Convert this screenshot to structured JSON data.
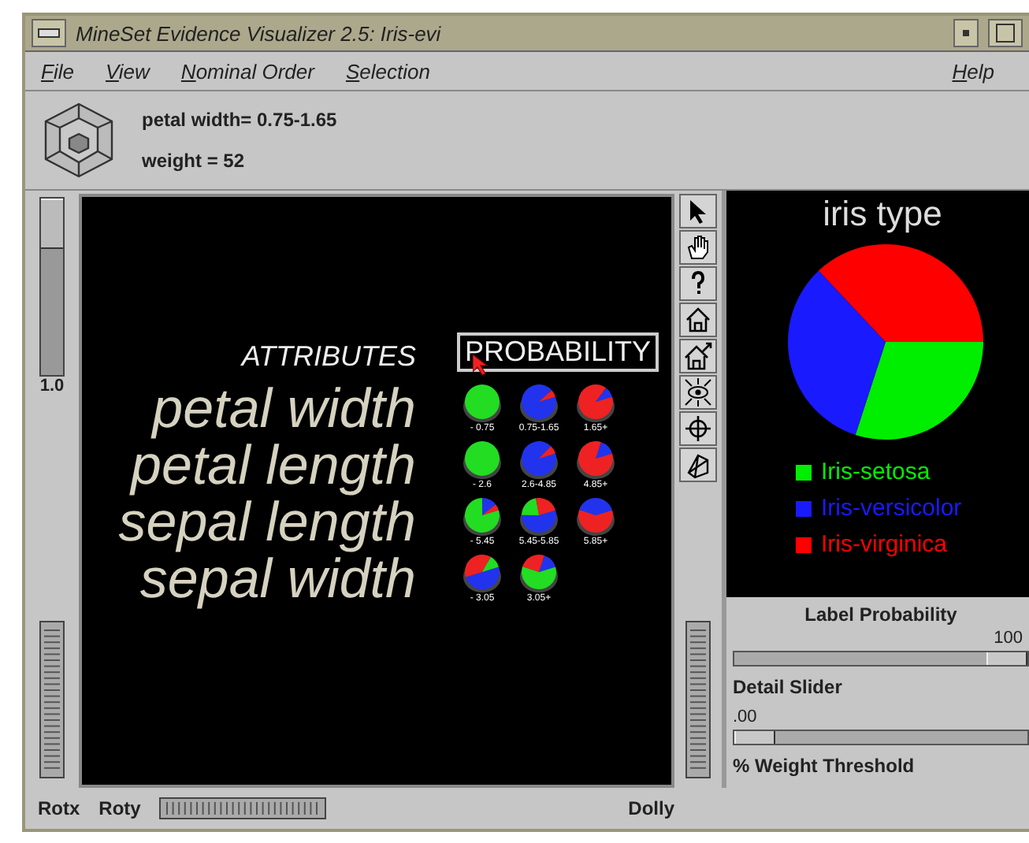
{
  "window": {
    "title": "MineSet Evidence Visualizer 2.5: Iris-evi"
  },
  "menu": [
    {
      "label": "File"
    },
    {
      "label": "View"
    },
    {
      "label": "Nominal Order"
    },
    {
      "label": "Selection"
    },
    {
      "label": "Help"
    }
  ],
  "info": [
    "petal width= 0.75-1.65",
    "weight = 52"
  ],
  "left_slider": {
    "reading": "1.0",
    "level": 1
  },
  "canvas": {
    "attributes_heading": "ATTRIBUTES",
    "probability_heading": "PROBABILITY",
    "attributes": [
      {
        "name": "petal width",
        "pies": [
          {
            "label": "- 0.75"
          },
          {
            "label": "0.75-1.65"
          },
          {
            "label": "1.65+"
          }
        ]
      },
      {
        "name": "petal length",
        "pies": [
          {
            "label": "- 2.6"
          },
          {
            "label": "2.6-4.85"
          },
          {
            "label": "4.85+"
          }
        ]
      },
      {
        "name": "sepal length",
        "pies": [
          {
            "label": "- 5.45"
          },
          {
            "label": "5.45-5.85"
          },
          {
            "label": "5.85+"
          }
        ]
      },
      {
        "name": "sepal width",
        "pies": [
          {
            "label": "- 3.05"
          },
          {
            "label": "3.05+"
          }
        ]
      }
    ]
  },
  "class_chart": {
    "title": "iris type",
    "legend": [
      {
        "label": "Iris-setosa",
        "color": "#00ee00"
      },
      {
        "label": "Iris-versicolor",
        "color": "#1a1aff"
      },
      {
        "label": "Iris-virginica",
        "color": "#ff0000"
      }
    ]
  },
  "label_probability": {
    "label": "Label Probability",
    "reading": "100",
    "level": 1
  },
  "detail_slider": {
    "label": "Detail Slider",
    "reading": ".00",
    "level": 0
  },
  "weight_threshold": {
    "label": "% Weight Threshold"
  },
  "bottom_bar": {
    "rotx": "Rotx",
    "roty": "Roty",
    "dolly": "Dolly"
  }
}
